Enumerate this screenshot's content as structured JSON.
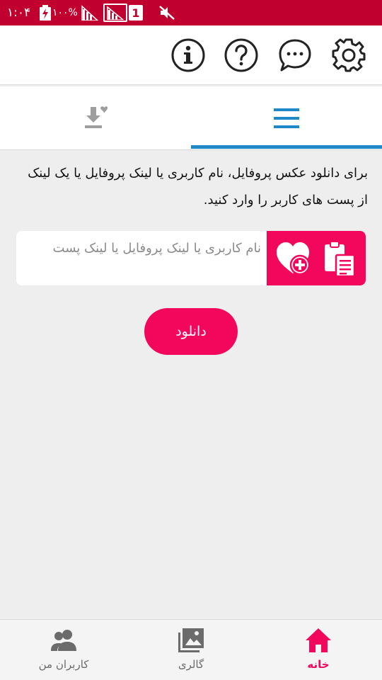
{
  "status_bar": {
    "time": "۱:۰۴",
    "battery": "۱۰۰%",
    "sim": "1",
    "color": "#c0002e"
  },
  "toolbar": {
    "icons": [
      "info-icon",
      "help-icon",
      "chat-icon",
      "settings-gear-icon"
    ]
  },
  "tabs": {
    "active": "menu",
    "indicator_color": "#1e88c9",
    "items": [
      "download-heart-icon",
      "menu-icon"
    ]
  },
  "main": {
    "instruction": "برای دانلود عکس پروفایل، نام کاربری یا لینک پروفایل یا یک لینک از پست های کاربر را وارد کنید.",
    "input_placeholder": "نام کاربری یا لینک پروفایل یا لینک پست",
    "input_value": "",
    "download_label": "دانلود",
    "accent_color": "#f2075d"
  },
  "bottom_nav": {
    "items": [
      {
        "label": "کاربران من",
        "icon": "users-icon"
      },
      {
        "label": "گالری",
        "icon": "gallery-icon"
      },
      {
        "label": "خانه",
        "icon": "home-icon",
        "active": true
      }
    ]
  }
}
